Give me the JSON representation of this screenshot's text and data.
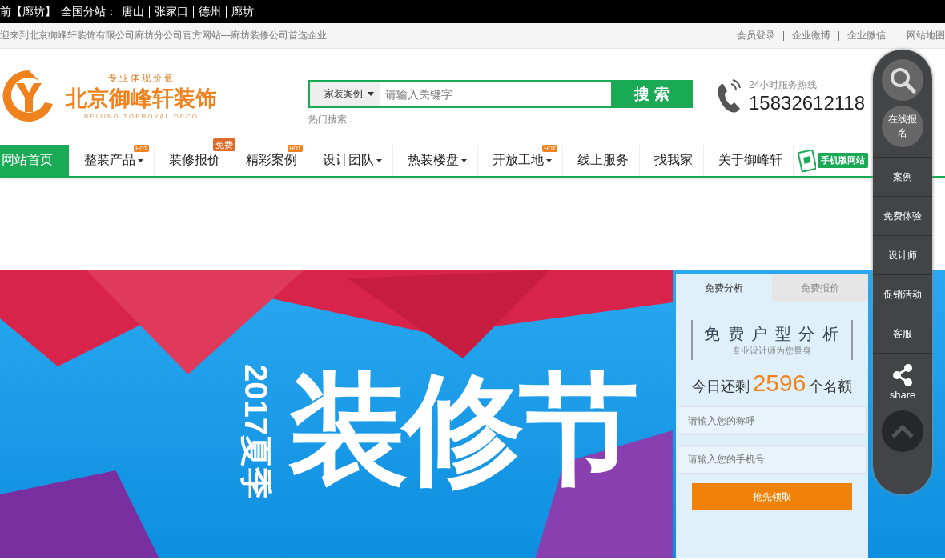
{
  "top_bar": {
    "current_city": "前【廊坊】",
    "stations_label": "全国分站：",
    "stations": [
      "唐山",
      "张家口",
      "德州",
      "廊坊"
    ]
  },
  "welcome_bar": {
    "text": "迎来到北京御峰轩装饰有限公司廊坊分公司官方网站—廊坊装修公司首选企业",
    "links": [
      "会员登录",
      "企业微博",
      "企业微信",
      "网站地图"
    ]
  },
  "header": {
    "logo": {
      "slogan": "专业体现价值",
      "name": "北京御峰轩装饰",
      "english": "BEIJING TOPROYAL DECO"
    },
    "search": {
      "category": "家装案例",
      "placeholder": "请输入关键字",
      "button": "搜 索",
      "hot_label": "热门搜索："
    },
    "hotline": {
      "label": "24小时服务热线",
      "number": "15832612118"
    }
  },
  "nav": {
    "items": [
      {
        "label": "网站首页",
        "selected": true,
        "dropdown": false
      },
      {
        "label": "整装产品",
        "selected": false,
        "dropdown": true,
        "badge": {
          "text": "HOT",
          "kind": "hot"
        }
      },
      {
        "label": "装修报价",
        "selected": false,
        "dropdown": false,
        "badge": {
          "text": "免费",
          "kind": "tag"
        }
      },
      {
        "label": "精彩案例",
        "selected": false,
        "dropdown": false,
        "badge": {
          "text": "HOT",
          "kind": "hot"
        }
      },
      {
        "label": "设计团队",
        "selected": false,
        "dropdown": true
      },
      {
        "label": "热装楼盘",
        "selected": false,
        "dropdown": true
      },
      {
        "label": "开放工地",
        "selected": false,
        "dropdown": true,
        "badge": {
          "text": "HOT",
          "kind": "hot"
        }
      },
      {
        "label": "线上服务",
        "selected": false,
        "dropdown": false
      },
      {
        "label": "找我家",
        "selected": false,
        "dropdown": false
      },
      {
        "label": "关于御峰轩",
        "selected": false,
        "dropdown": false
      }
    ],
    "mobile_site": "手机版网站"
  },
  "banner": {
    "year_season": "2017夏季",
    "headline": "装修节"
  },
  "form_panel": {
    "tabs": [
      {
        "label": "免费分析",
        "selected": true
      },
      {
        "label": "免费报价",
        "selected": false
      }
    ],
    "title": "免 费 户 型 分 析",
    "subtitle": "专业设计师为您量身",
    "remaining_prefix": "今日还剩",
    "remaining_count": "2596",
    "remaining_suffix": "个名额",
    "fields": [
      {
        "placeholder": "请输入您的称呼"
      },
      {
        "placeholder": "请输入您的手机号"
      }
    ],
    "button": "抢先领取"
  },
  "float_sidebar": {
    "signup": "在线报名",
    "items": [
      "案例",
      "免费体验",
      "设计师",
      "促销活动",
      "客服"
    ],
    "share": "share"
  }
}
